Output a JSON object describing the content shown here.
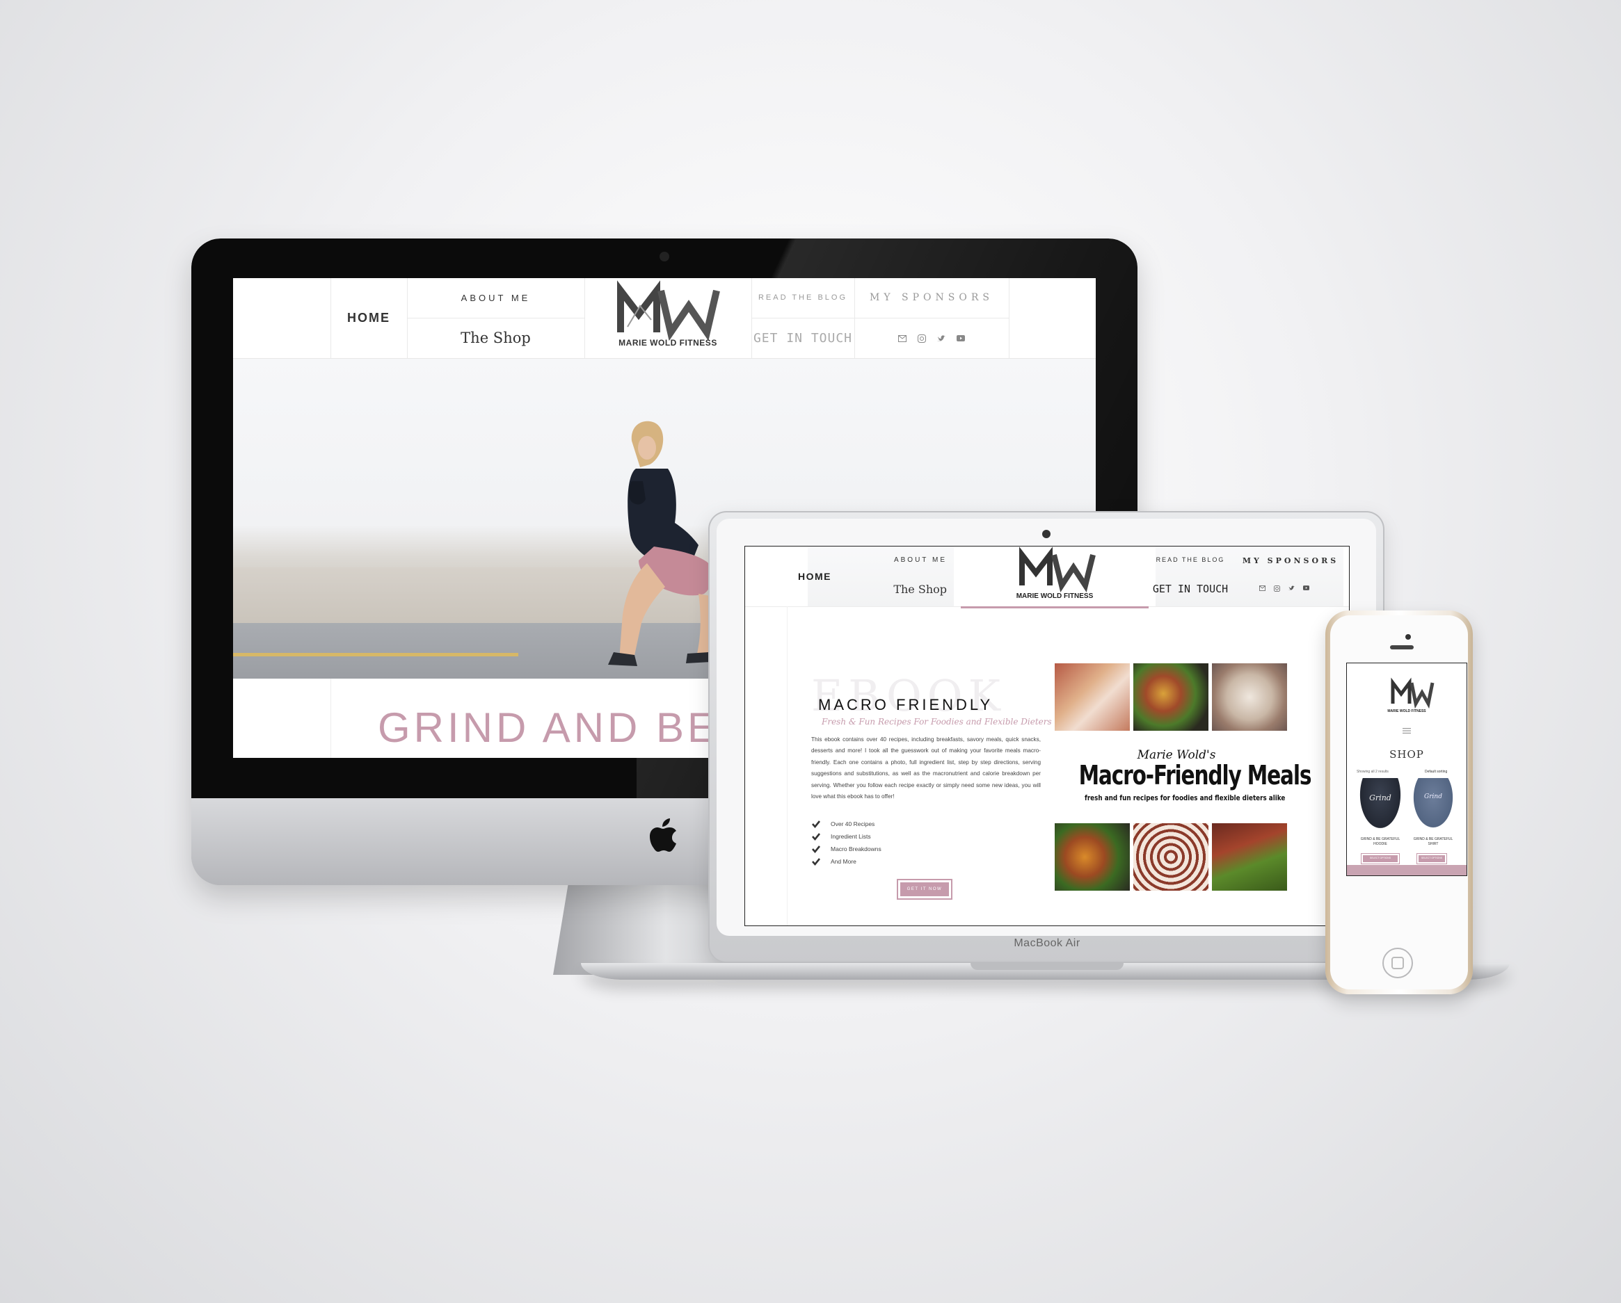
{
  "brand": {
    "logo_text": "MARIE WOLD FITNESS",
    "accent_color": "#c69bac"
  },
  "desktop": {
    "nav": {
      "home": "HOME",
      "about": "ABOUT ME",
      "shop": "The Shop",
      "blog": "READ THE BLOG",
      "contact": "GET IN TOUCH",
      "sponsors": "MY SPONSORS",
      "social_icons": [
        "email-icon",
        "instagram-icon",
        "twitter-icon",
        "youtube-icon"
      ]
    },
    "hero_heading": "GRIND AND BE"
  },
  "laptop": {
    "nav": {
      "home": "HOME",
      "about": "ABOUT ME",
      "shop": "The Shop",
      "blog": "READ THE BLOG",
      "contact": "GET IN TOUCH",
      "sponsors": "MY SPONSORS"
    },
    "ebook_bg": "EBOOK",
    "title": "MACRO FRIENDLY",
    "tagline": "Fresh & Fun Recipes For Foodies and Flexible Dieters",
    "description": "This ebook contains over 40 recipes, including breakfasts, savory meals, quick snacks, desserts and more! I took all the guesswork out of making your favorite meals macro-friendly. Each one contains a photo, full ingredient list, step by step directions, serving suggestions and substitutions, as well as the macronutrient and calorie breakdown per serving. Whether you follow each recipe exactly or simply need some new ideas, you will love what this ebook has to offer!",
    "features": [
      "Over 40 Recipes",
      "Ingredient Lists",
      "Macro Breakdowns",
      "And More"
    ],
    "button": "GET IT NOW",
    "book_author": "Marie Wold's",
    "book_title": "Macro-Friendly Meals",
    "book_subtitle": "fresh and fun recipes for foodies and flexible dieters alike",
    "device_label": "MacBook Air"
  },
  "phone": {
    "heading": "SHOP",
    "showing": "Showing all 2 results",
    "sort": "Default sorting",
    "products": [
      {
        "name": "GRIND & BE GRATEFUL HOODIE",
        "button": "SELECT OPTIONS"
      },
      {
        "name": "GRIND & BE GRATEFUL SHIRT",
        "button": "SELECT OPTIONS"
      }
    ]
  }
}
